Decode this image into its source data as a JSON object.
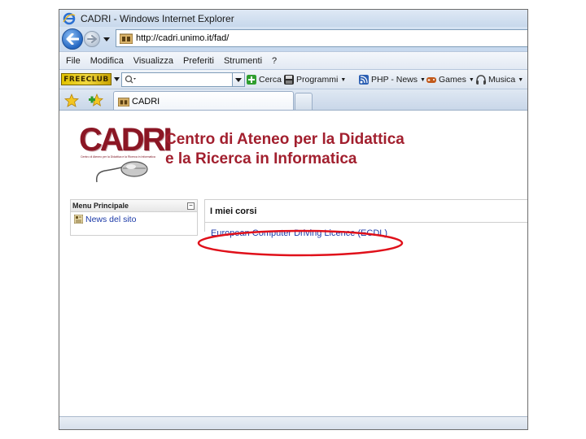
{
  "window": {
    "title": "CADRI - Windows Internet Explorer"
  },
  "address": {
    "url": "http://cadri.unimo.it/fad/"
  },
  "menu": {
    "items": [
      "File",
      "Modifica",
      "Visualizza",
      "Preferiti",
      "Strumenti",
      "?"
    ]
  },
  "linksbar": {
    "brand": "FREECLUB",
    "search_value": "",
    "items": [
      {
        "label": "Cerca",
        "color": "#2f9e2f"
      },
      {
        "label": "Programmi",
        "color": "#2b5fb3"
      },
      {
        "label": "PHP - News",
        "color": "#2b5fb3"
      },
      {
        "label": "Games",
        "color": "#c25a1b"
      },
      {
        "label": "Musica",
        "color": "#555555"
      }
    ]
  },
  "tabs": {
    "active_label": "CADRI"
  },
  "page": {
    "banner": {
      "logo": "CADRI",
      "logo_sub": "Centro di Ateneo per la Didattica e la Ricerca in Informatica",
      "headline_line1": "Centro di Ateneo per la Didattica",
      "headline_line2": "e la Ricerca in Informatica"
    },
    "sidebar": {
      "title": "Menu Principale",
      "collapse": "−",
      "items": [
        {
          "label": "News del sito"
        }
      ]
    },
    "courses": {
      "title": "I miei corsi",
      "items": [
        {
          "label": "European Computer Driving Licence (ECDL)"
        }
      ]
    }
  },
  "colors": {
    "brand_red": "#a21f2e",
    "link_blue": "#1c3aa8",
    "highlight_ellipse": "#e0101a"
  }
}
